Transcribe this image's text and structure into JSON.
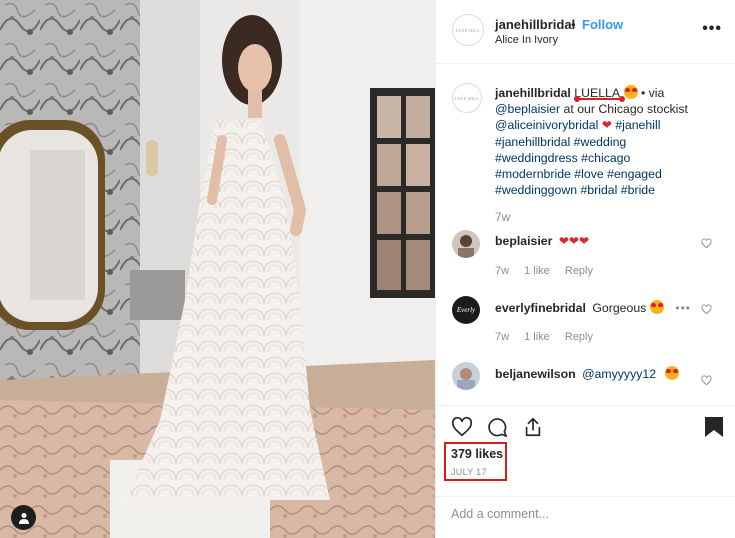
{
  "post": {
    "username": "janehillbridal",
    "dot": "•",
    "follow_label": "Follow",
    "location": "Alice In Ivory",
    "more_label": "•••",
    "avatar_text": "JANE HILL"
  },
  "caption": {
    "username": "janehillbridal",
    "tag_luella": "LUELLA",
    "via": "• via",
    "mention_beplaisier": "@beplaisier",
    "at_text": "at our Chicago stockist",
    "mention_alice": "@aliceinivorybridal",
    "tags_line1": "#janehill",
    "tags_line2": "#janehillbridal #wedding",
    "tags_line3": "#weddingdress #chicago",
    "tags_line4": "#modernbride #love #engaged",
    "tags_line5": "#weddinggown #bridal #bride",
    "time": "7w"
  },
  "comments": [
    {
      "username": "beplaisier",
      "text": "",
      "time": "7w",
      "likes": "1 like",
      "reply": "Reply"
    },
    {
      "username": "everlyfinebridal",
      "text": "Gorgeous",
      "time": "7w",
      "likes": "1 like",
      "reply": "Reply",
      "avatar_text": "Everly"
    },
    {
      "username": "beljanewilson",
      "text": "@amyyyyy12",
      "time": "",
      "likes": "",
      "reply": ""
    }
  ],
  "actions": {
    "likes": "379 likes",
    "date": "JULY 17",
    "add_comment_placeholder": "Add a comment..."
  },
  "colors": {
    "follow_blue": "#3897f0",
    "link_navy": "#003569",
    "annotation_red": "#d31f1f"
  },
  "icons": [
    "heart-icon",
    "comment-icon",
    "share-icon",
    "bookmark-icon",
    "user-tag-icon",
    "more-icon"
  ]
}
